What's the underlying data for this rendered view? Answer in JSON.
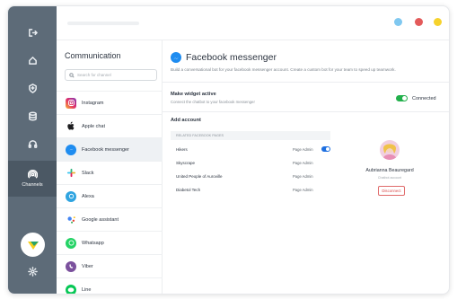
{
  "window": {
    "dots": [
      "#80c8f0",
      "#e35a5a",
      "#f6d22c"
    ]
  },
  "rail": {
    "active_label": "Channels"
  },
  "channels_panel": {
    "title": "Communication",
    "search_placeholder": "Search for channel",
    "items": [
      {
        "label": "Instagram",
        "icon": "instagram-icon"
      },
      {
        "label": "Apple chat",
        "icon": "apple-icon"
      },
      {
        "label": "Facebook messenger",
        "icon": "messenger-icon"
      },
      {
        "label": "Slack",
        "icon": "slack-icon"
      },
      {
        "label": "Alexa",
        "icon": "alexa-icon"
      },
      {
        "label": "Google assistant",
        "icon": "google-assistant-icon"
      },
      {
        "label": "Whatsapp",
        "icon": "whatsapp-icon"
      },
      {
        "label": "Viber",
        "icon": "viber-icon"
      },
      {
        "label": "Line",
        "icon": "line-icon"
      }
    ]
  },
  "main": {
    "title": "Facebook messenger",
    "description": "Build a conversational bot for your facebook messenger account. Create a custom bot for your team to speed up teamwork.",
    "widget": {
      "title": "Make widget active",
      "subtitle": "Connect the chatbot to your facebook messenger",
      "status": "Connected"
    },
    "account": {
      "title": "Add account",
      "pages_header": "RELATED FACEBOOK PAGES",
      "pages": [
        {
          "name": "Hikers",
          "role": "Page Admin",
          "enabled": true
        },
        {
          "name": "Skyscrape",
          "role": "Page Admin"
        },
        {
          "name": "United People of Auroville",
          "role": "Page Admin"
        },
        {
          "name": "Diabetol Tech",
          "role": "Page Admin"
        }
      ],
      "user": {
        "name": "Aubrianna Beauregard",
        "role": "Chatbot account",
        "disconnect_label": "Disconnect"
      }
    }
  }
}
